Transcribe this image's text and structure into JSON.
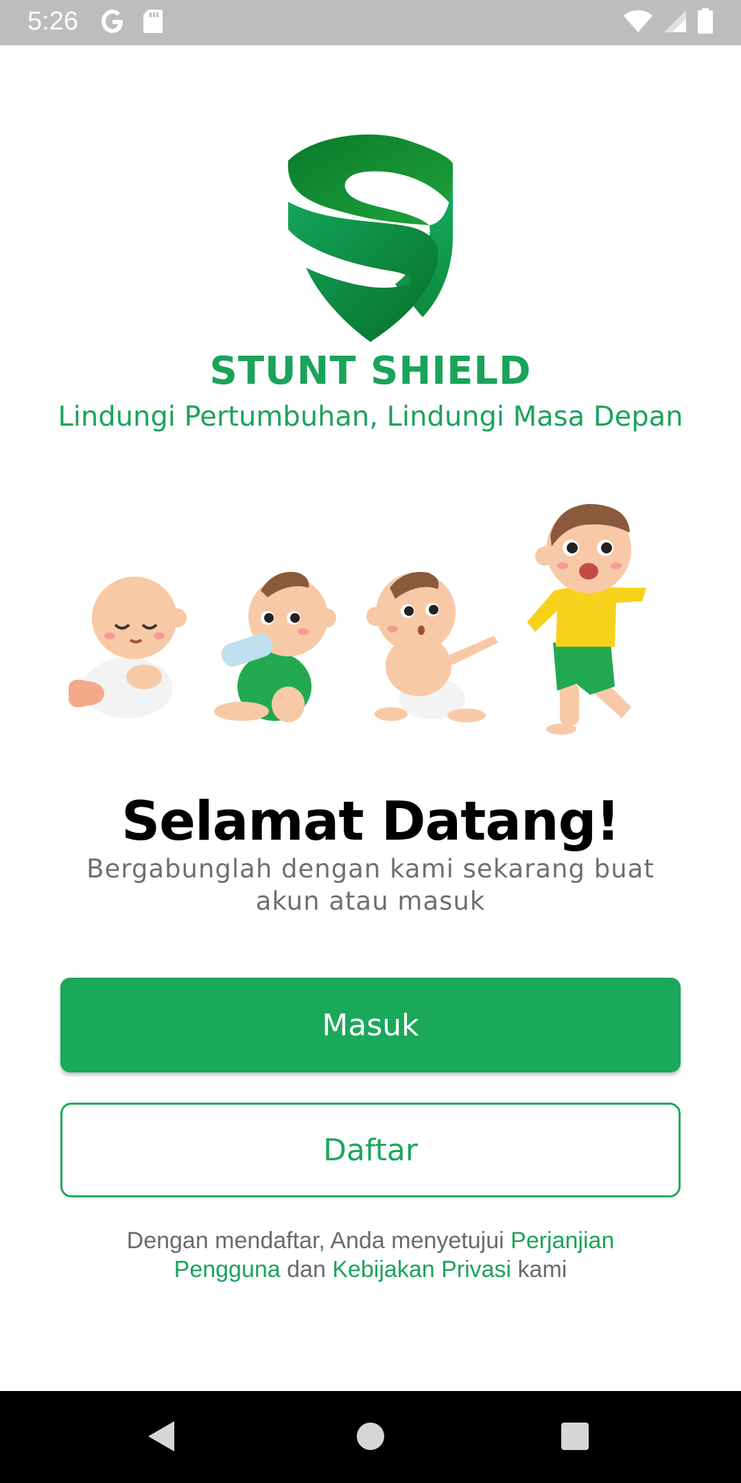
{
  "status_bar": {
    "time": "5:26",
    "icons_left": [
      "google-icon",
      "sd-card-icon"
    ],
    "icons_right": [
      "wifi-icon",
      "signal-icon",
      "battery-icon"
    ]
  },
  "brand": {
    "name": "STUNT SHIELD",
    "tagline": "Lindungi Pertumbuhan, Lindungi Masa Depan",
    "color": "#1aa35a"
  },
  "illustration": {
    "description_icons": [
      "baby-sleeping",
      "baby-bottle",
      "baby-crawling",
      "toddler-walking"
    ]
  },
  "welcome": {
    "title": "Selamat Datang!",
    "subtitle": "Bergabunglah dengan kami sekarang buat akun atau masuk"
  },
  "buttons": {
    "login_label": "Masuk",
    "register_label": "Daftar",
    "primary_color": "#1aa85a"
  },
  "terms": {
    "prefix": "Dengan mendaftar, Anda menyetujui ",
    "user_agreement": "Perjanjian Pengguna",
    "middle": " dan ",
    "privacy_policy": "Kebijakan Privasi",
    "suffix": " kami"
  },
  "nav_bar": {
    "buttons": [
      "back-icon",
      "home-icon",
      "recents-icon"
    ]
  }
}
